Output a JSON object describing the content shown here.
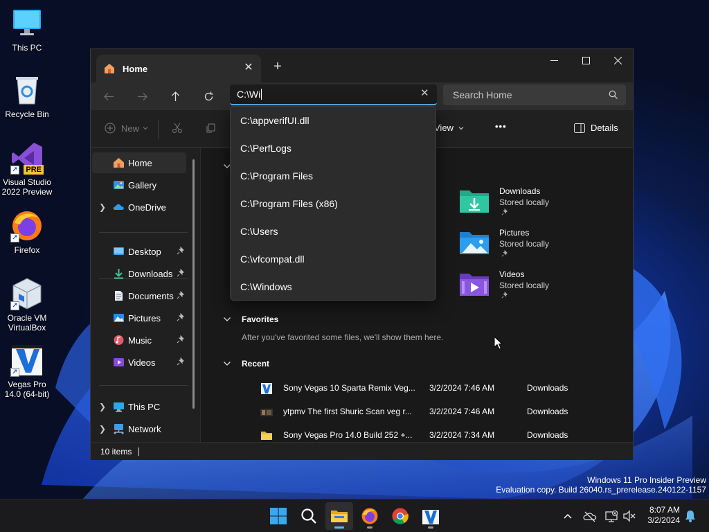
{
  "desktop": {
    "icons": [
      {
        "label": "This PC",
        "icon": "this-pc-icon"
      },
      {
        "label": "Recycle Bin",
        "icon": "recycle-bin-icon"
      },
      {
        "label": "Visual Studio 2022 Preview",
        "icon": "visual-studio-icon",
        "badge": "PRE"
      },
      {
        "label": "Firefox",
        "icon": "firefox-icon"
      },
      {
        "label": "Oracle VM VirtualBox",
        "icon": "virtualbox-icon"
      },
      {
        "label": "Vegas Pro 14.0 (64-bit)",
        "icon": "vegas-pro-icon"
      }
    ]
  },
  "window": {
    "tab_title": "Home",
    "tab_close": "✕",
    "new_tab": "+",
    "address_value": "C:\\Wi",
    "address_clear": "✕",
    "search_placeholder": "Search Home",
    "toolbar": {
      "new_label": "New",
      "view_label": "View",
      "more_label": "•••",
      "details_label": "Details"
    },
    "sidebar": {
      "items": [
        {
          "label": "Home",
          "icon": "home-icon",
          "active": true
        },
        {
          "label": "Gallery",
          "icon": "gallery-icon"
        },
        {
          "label": "OneDrive",
          "icon": "onedrive-icon",
          "expandable": true
        },
        {
          "label": "Desktop",
          "icon": "desktop-folder-icon",
          "pinned": true
        },
        {
          "label": "Downloads",
          "icon": "downloads-folder-icon",
          "pinned": true
        },
        {
          "label": "Documents",
          "icon": "documents-folder-icon",
          "pinned": true
        },
        {
          "label": "Pictures",
          "icon": "pictures-folder-icon",
          "pinned": true
        },
        {
          "label": "Music",
          "icon": "music-folder-icon",
          "pinned": true
        },
        {
          "label": "Videos",
          "icon": "videos-folder-icon",
          "pinned": true
        },
        {
          "label": "This PC",
          "icon": "this-pc-icon",
          "expandable": true
        },
        {
          "label": "Network",
          "icon": "network-icon",
          "expandable": true
        }
      ]
    },
    "quick_access": [
      {
        "name": "Downloads",
        "status": "Stored locally",
        "icon": "downloads-folder-icon"
      },
      {
        "name": "Pictures",
        "status": "Stored locally",
        "icon": "pictures-folder-icon"
      },
      {
        "name": "Videos",
        "status": "Stored locally",
        "icon": "videos-folder-icon"
      }
    ],
    "favorites": {
      "title": "Favorites",
      "empty_text": "After you've favorited some files, we'll show them here."
    },
    "recent": {
      "title": "Recent",
      "rows": [
        {
          "name": "Sony Vegas 10 Sparta Remix Veg...",
          "date": "3/2/2024 7:46 AM",
          "location": "Downloads",
          "icon": "vegas-file-icon"
        },
        {
          "name": "ytpmv The first Shuric Scan veg r...",
          "date": "3/2/2024 7:46 AM",
          "location": "Downloads",
          "icon": "video-file-icon"
        },
        {
          "name": "Sony Vegas Pro 14.0 Build 252 +...",
          "date": "3/2/2024 7:34 AM",
          "location": "Downloads",
          "icon": "folder-icon"
        }
      ]
    },
    "status": {
      "items_count": "10 items"
    },
    "address_suggestions": [
      "C:\\appverifUI.dll",
      "C:\\PerfLogs",
      "C:\\Program Files",
      "C:\\Program Files (x86)",
      "C:\\Users",
      "C:\\vfcompat.dll",
      "C:\\Windows"
    ]
  },
  "watermark": {
    "line1": "Windows 11 Pro Insider Preview",
    "line2": "Evaluation copy. Build 26040.rs_prerelease.240122-1157"
  },
  "taskbar": {
    "apps": [
      "start-icon",
      "search-icon",
      "file-explorer-icon",
      "firefox-icon",
      "chrome-icon",
      "vegas-pro-icon"
    ],
    "time": "8:07 AM",
    "date": "3/2/2024"
  },
  "colors": {
    "accent": "#60b8f0",
    "window_bg": "#202020",
    "content_bg": "#191919"
  }
}
